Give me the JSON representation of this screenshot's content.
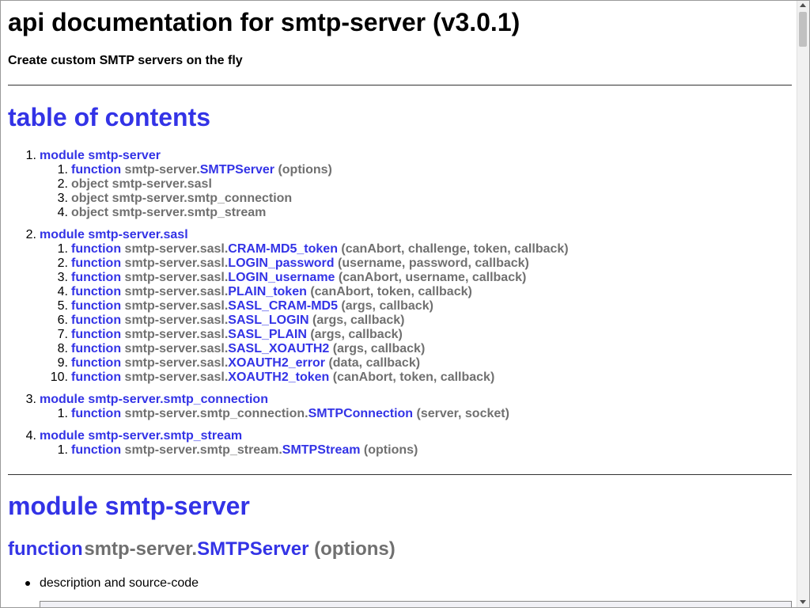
{
  "page": {
    "title": "api documentation for smtp-server (v3.0.1)",
    "subtitle": "Create custom SMTP servers on the fly"
  },
  "toc": {
    "heading": "table of contents",
    "modules": [
      {
        "num": "1.",
        "kind": "module",
        "name": "smtp-server",
        "items": [
          {
            "num": "1.",
            "kind": "function",
            "prefix": "smtp-server.",
            "name": "SMTPServer",
            "args": "(options)"
          },
          {
            "num": "2.",
            "kind": "object",
            "prefix": "smtp-server.sasl",
            "name": "",
            "args": ""
          },
          {
            "num": "3.",
            "kind": "object",
            "prefix": "smtp-server.smtp_connection",
            "name": "",
            "args": ""
          },
          {
            "num": "4.",
            "kind": "object",
            "prefix": "smtp-server.smtp_stream",
            "name": "",
            "args": ""
          }
        ]
      },
      {
        "num": "2.",
        "kind": "module",
        "name": "smtp-server.sasl",
        "items": [
          {
            "num": "1.",
            "kind": "function",
            "prefix": "smtp-server.sasl.",
            "name": "CRAM-MD5_token",
            "args": "(canAbort, challenge, token, callback)"
          },
          {
            "num": "2.",
            "kind": "function",
            "prefix": "smtp-server.sasl.",
            "name": "LOGIN_password",
            "args": "(username, password, callback)"
          },
          {
            "num": "3.",
            "kind": "function",
            "prefix": "smtp-server.sasl.",
            "name": "LOGIN_username",
            "args": "(canAbort, username, callback)"
          },
          {
            "num": "4.",
            "kind": "function",
            "prefix": "smtp-server.sasl.",
            "name": "PLAIN_token",
            "args": "(canAbort, token, callback)"
          },
          {
            "num": "5.",
            "kind": "function",
            "prefix": "smtp-server.sasl.",
            "name": "SASL_CRAM-MD5",
            "args": "(args, callback)"
          },
          {
            "num": "6.",
            "kind": "function",
            "prefix": "smtp-server.sasl.",
            "name": "SASL_LOGIN",
            "args": "(args, callback)"
          },
          {
            "num": "7.",
            "kind": "function",
            "prefix": "smtp-server.sasl.",
            "name": "SASL_PLAIN",
            "args": "(args, callback)"
          },
          {
            "num": "8.",
            "kind": "function",
            "prefix": "smtp-server.sasl.",
            "name": "SASL_XOAUTH2",
            "args": "(args, callback)"
          },
          {
            "num": "9.",
            "kind": "function",
            "prefix": "smtp-server.sasl.",
            "name": "XOAUTH2_error",
            "args": "(data, callback)"
          },
          {
            "num": "10.",
            "kind": "function",
            "prefix": "smtp-server.sasl.",
            "name": "XOAUTH2_token",
            "args": "(canAbort, token, callback)"
          }
        ]
      },
      {
        "num": "3.",
        "kind": "module",
        "name": "smtp-server.smtp_connection",
        "items": [
          {
            "num": "1.",
            "kind": "function",
            "prefix": "smtp-server.smtp_connection.",
            "name": "SMTPConnection",
            "args": "(server, socket)"
          }
        ]
      },
      {
        "num": "4.",
        "kind": "module",
        "name": "smtp-server.smtp_stream",
        "items": [
          {
            "num": "1.",
            "kind": "function",
            "prefix": "smtp-server.smtp_stream.",
            "name": "SMTPStream",
            "args": "(options)"
          }
        ]
      }
    ]
  },
  "section": {
    "module_heading": "module smtp-server",
    "function_heading": {
      "kind": "function",
      "prefix": "smtp-server.",
      "name": "SMTPServer",
      "args": "(options)"
    },
    "bullet": "description and source-code"
  },
  "colors": {
    "link": "#3333e6",
    "muted": "#707070"
  },
  "icons": {
    "scroll_up": "triangle-up",
    "scroll_down": "triangle-down"
  }
}
